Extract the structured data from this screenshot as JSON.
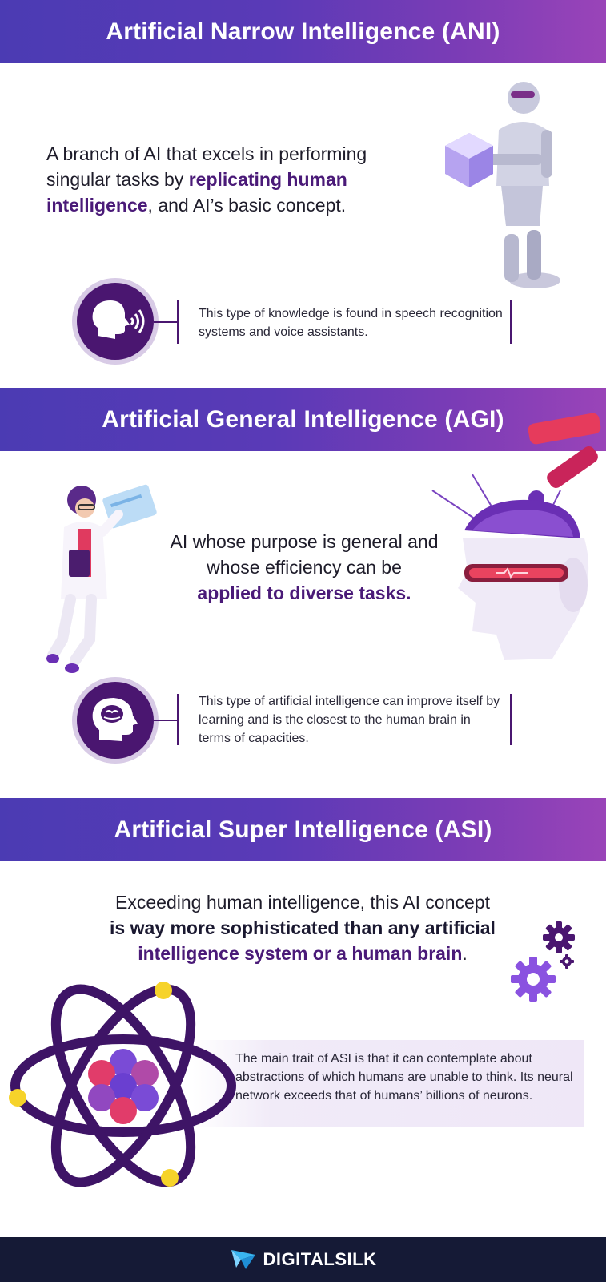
{
  "sections": {
    "ani": {
      "title": "Artificial Narrow Intelligence (ANI)",
      "lead_part1": "A branch of AI that excels in performing singular tasks by ",
      "lead_highlight": "replicating human intelligence",
      "lead_part2": ", and AI’s basic concept.",
      "note": "This type of knowledge is found in speech recognition systems and voice assistants."
    },
    "agi": {
      "title": "Artificial General Intelligence (AGI)",
      "lead_part1": "AI whose purpose is general and whose efficiency can be",
      "lead_highlight": "applied to diverse tasks.",
      "note": "This type of artificial intelligence can improve itself by learning and is the closest to the human brain in terms of capacities."
    },
    "asi": {
      "title": "Artificial Super Intelligence (ASI)",
      "lead_part1": "Exceeding human intelligence, this AI concept",
      "lead_bold": "is way more sophisticated than any artificial",
      "lead_highlight": "intelligence system or a human brain",
      "lead_end": ".",
      "note": "The main trait of ASI is that it can contemplate about abstractions of which humans are unable to think. Its neural network exceeds that of humans’ billions of neurons."
    }
  },
  "footer": {
    "brand": "DIGITALSILK"
  },
  "colors": {
    "banner_start": "#4b3bb3",
    "banner_end": "#9a44b8",
    "accent_purple": "#4a1670",
    "footer_bg": "#151a36"
  },
  "icons": [
    "robot-illustration",
    "speech-head-icon",
    "scientist-illustration",
    "robot-brain-head-illustration",
    "brain-head-icon",
    "gears-icon",
    "atom-illustration",
    "digitalsilk-logo-icon"
  ]
}
